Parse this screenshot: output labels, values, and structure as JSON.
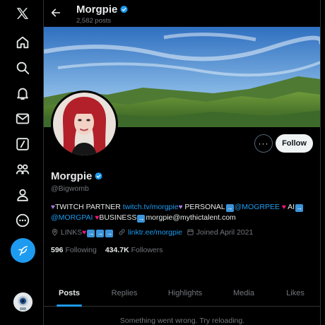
{
  "nav": {
    "items": [
      {
        "name": "x-logo-icon"
      },
      {
        "name": "home-icon"
      },
      {
        "name": "search-icon"
      },
      {
        "name": "notifications-icon"
      },
      {
        "name": "messages-icon"
      },
      {
        "name": "grok-icon"
      },
      {
        "name": "communities-icon"
      },
      {
        "name": "profile-icon"
      },
      {
        "name": "more-icon"
      }
    ],
    "compose_icon": "feather-icon"
  },
  "header": {
    "name": "Morgpie",
    "post_count": "2,582 posts"
  },
  "profile": {
    "display_name": "Morgpie",
    "handle": "@Bigwomb",
    "follow_label": "Follow",
    "more_label": "···",
    "bio": {
      "part1": "TWITCH PARTNER ",
      "twitch_link": "twitch.tv/morgpie",
      "part2": " PERSONAL",
      "personal_handle": "@MOGRPEE",
      "part3": " AI",
      "ai_handle": "@MORGPAI",
      "part4": "BUSINESS",
      "email": "morgpie@mythictalent.com"
    },
    "links_label": "LINKS",
    "links_url": "linktr.ee/morgpie",
    "joined": "Joined April 2021",
    "following_count": "596",
    "following_label": "Following",
    "followers_count": "434.7K",
    "followers_label": "Followers"
  },
  "tabs": [
    {
      "label": "Posts",
      "active": true
    },
    {
      "label": "Replies",
      "active": false
    },
    {
      "label": "Highlights",
      "active": false
    },
    {
      "label": "Media",
      "active": false
    },
    {
      "label": "Likes",
      "active": false
    }
  ],
  "feed": {
    "error_message": "Something went wrong. Try reloading."
  },
  "colors": {
    "accent": "#1d9bf0",
    "background": "#000000",
    "muted_text": "#71767b",
    "heart": "#f91880",
    "purple_heart": "#a87ee0"
  }
}
